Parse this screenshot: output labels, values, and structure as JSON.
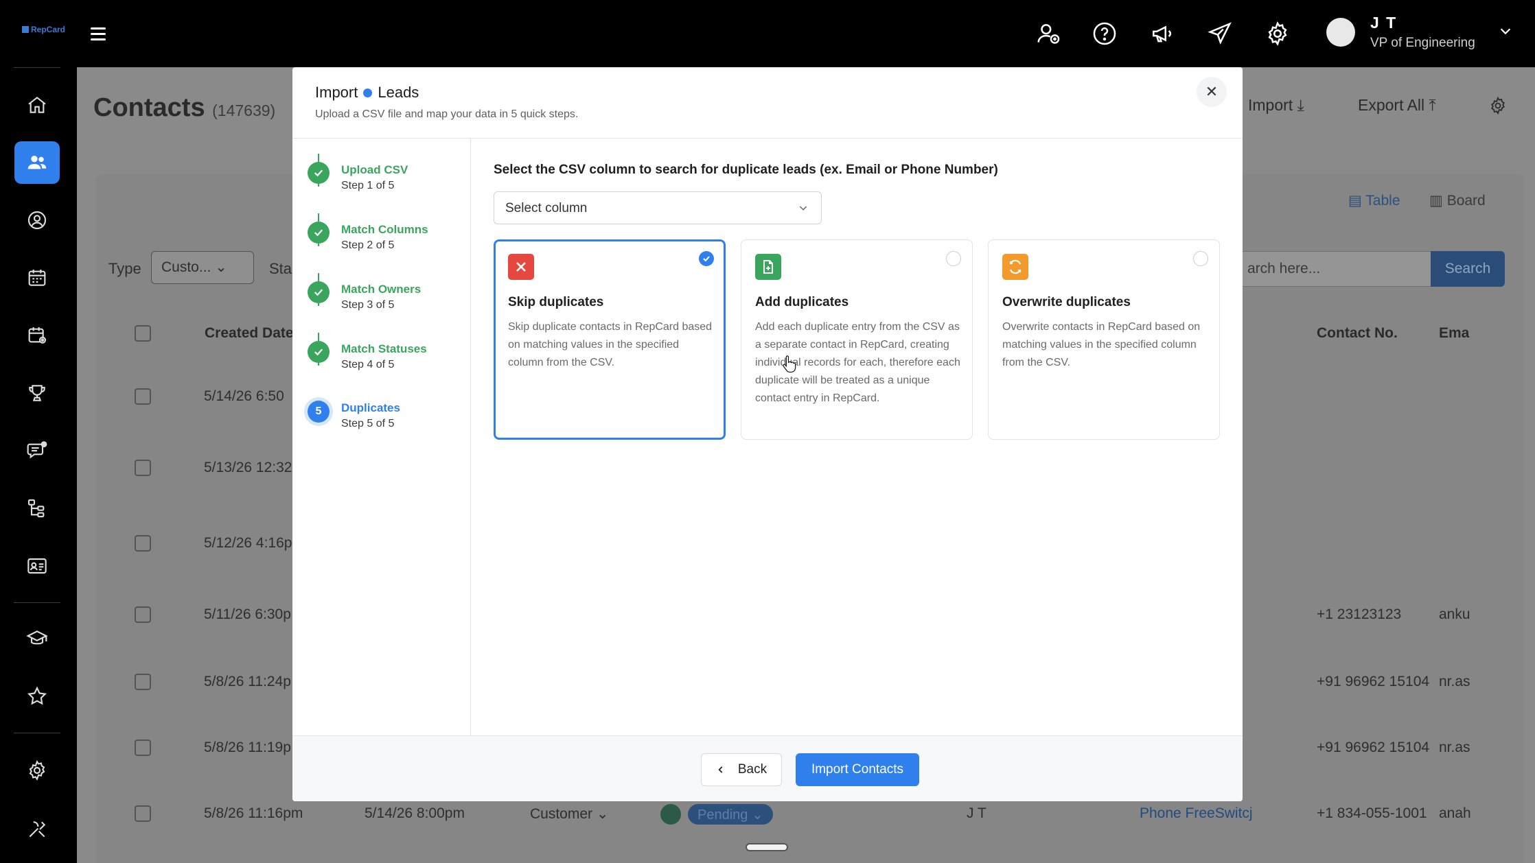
{
  "topbar": {
    "logo_text": "RepCard",
    "icons": [
      "add-user-icon",
      "help-icon",
      "megaphone-icon",
      "send-icon",
      "settings-icon"
    ],
    "user": {
      "name": "J T",
      "role": "VP of Engineering"
    }
  },
  "sidebar": {
    "items": [
      "home-icon",
      "contacts-icon",
      "leaderboard-user-icon",
      "calendar-icon",
      "calendar-settings-icon",
      "trophy-icon",
      "chat-icon",
      "org-chart-icon",
      "id-card-icon",
      "education-icon",
      "star-icon",
      "settings-icon",
      "tools-icon"
    ],
    "active": "contacts-icon"
  },
  "page": {
    "title": "Contacts",
    "count": "(147639)",
    "import_label": "Import",
    "export_label": "Export All",
    "view_tabs": [
      "Table",
      "Board"
    ],
    "type_label": "Type",
    "type_value": "Custo...",
    "status_label_partial": "Sta",
    "search_placeholder": "arch here...",
    "search_button": "Search",
    "columns": [
      "Created Date",
      "Contact No.",
      "Ema"
    ],
    "rows": [
      {
        "created": "5/14/26 6:50",
        "phone": "",
        "email": ""
      },
      {
        "created": "5/13/26 12:32",
        "phone": "",
        "email": ""
      },
      {
        "created": "5/12/26 4:16p",
        "phone": "",
        "email": ""
      },
      {
        "created": "5/11/26 6:30p",
        "phone": "+1 23123123",
        "email": "anku"
      },
      {
        "created": "5/8/26 11:24p",
        "phone": "+91 96962 15104",
        "email": "nr.as"
      },
      {
        "created": "5/8/26 11:19p",
        "phone": "+91 96962 15104",
        "email": "nr.as"
      },
      {
        "created": "5/8/26 11:16pm",
        "updated": "5/14/26 8:00pm",
        "type": "Customer",
        "status": "Pending",
        "owner": "J T",
        "source": "Phone FreeSwitcj",
        "phone": "+1 834-055-1001",
        "email": "anah"
      }
    ]
  },
  "modal": {
    "title_left": "Import",
    "title_right": "Leads",
    "subtitle": "Upload a CSV file and map your data in 5 quick steps.",
    "steps": [
      {
        "name": "Upload CSV",
        "sub": "Step 1 of 5",
        "state": "done"
      },
      {
        "name": "Match Columns",
        "sub": "Step 2 of 5",
        "state": "done"
      },
      {
        "name": "Match Owners",
        "sub": "Step 3 of 5",
        "state": "done"
      },
      {
        "name": "Match Statuses",
        "sub": "Step 4 of 5",
        "state": "done"
      },
      {
        "name": "Duplicates",
        "sub": "Step 5 of 5",
        "state": "current",
        "number": "5"
      }
    ],
    "question": "Select the CSV column to search for duplicate leads (ex. Email or Phone Number)",
    "select_placeholder": "Select column",
    "options": [
      {
        "title": "Skip duplicates",
        "desc": "Skip duplicate contacts in RepCard based on matching values in the specified column from the CSV.",
        "icon": "x-icon",
        "color": "#e5483e",
        "selected": true
      },
      {
        "title": "Add duplicates",
        "desc": "Add each duplicate entry from the CSV as a separate contact in RepCard, creating individual records for each, therefore each duplicate will be treated as a unique contact entry in RepCard.",
        "icon": "file-plus-icon",
        "color": "#3aa55d",
        "selected": false
      },
      {
        "title": "Overwrite duplicates",
        "desc": "Overwrite contacts in RepCard based on matching values in the specified column from the CSV.",
        "icon": "refresh-icon",
        "color": "#f39a2d",
        "selected": false
      }
    ],
    "back_label": "Back",
    "import_label": "Import Contacts"
  }
}
